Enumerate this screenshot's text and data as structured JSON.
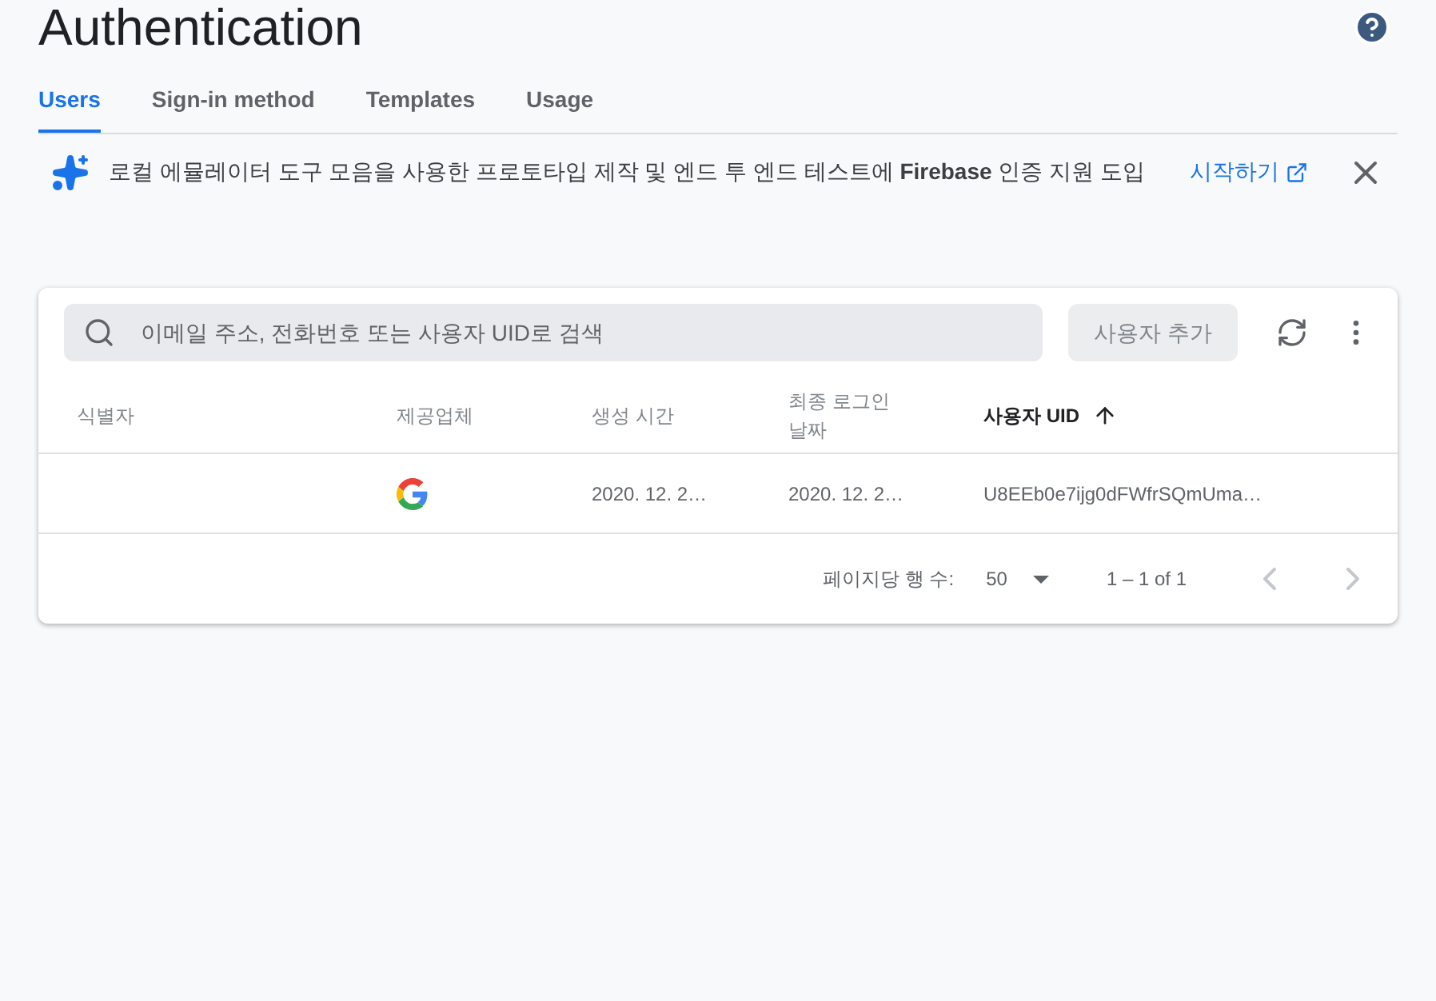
{
  "page_title": "Authentication",
  "tabs": [
    {
      "label": "Users",
      "selected": true
    },
    {
      "label": "Sign-in method",
      "selected": false
    },
    {
      "label": "Templates",
      "selected": false
    },
    {
      "label": "Usage",
      "selected": false
    }
  ],
  "banner": {
    "text": "로컬 에뮬레이터 도구 모음을 사용한 프로토타입 제작 및 엔드 투 엔드 테스트에 **Firebase** 인증 지원 도입",
    "link": "시작하기"
  },
  "search": {
    "placeholder": "이메일 주소, 전화번호 또는 사용자 UID로 검색"
  },
  "add_user_button": {
    "label": "사용자 추가",
    "disabled": true
  },
  "table": {
    "columns": [
      {
        "label": "식별자",
        "sorted": false
      },
      {
        "label": "제공업체",
        "sorted": false
      },
      {
        "label": "생성 시간",
        "sorted": false
      },
      {
        "label": "최종 로그인 날짜",
        "sorted": false
      },
      {
        "label": "사용자 UID",
        "sorted": true
      }
    ],
    "rows": [
      {
        "kind": "google",
        "created": "2020. 12. 2…",
        "last_login": "2020. 12. 2…",
        "uid": "U8EEb0e7ijg0dFWfrSQmUma…"
      }
    ]
  },
  "pagination": {
    "rows_per_page_label": "페이지당 행 수:",
    "rows_per_page": "50",
    "range": "1 – 1 of 1",
    "prev_disabled": true,
    "next_disabled": true
  }
}
